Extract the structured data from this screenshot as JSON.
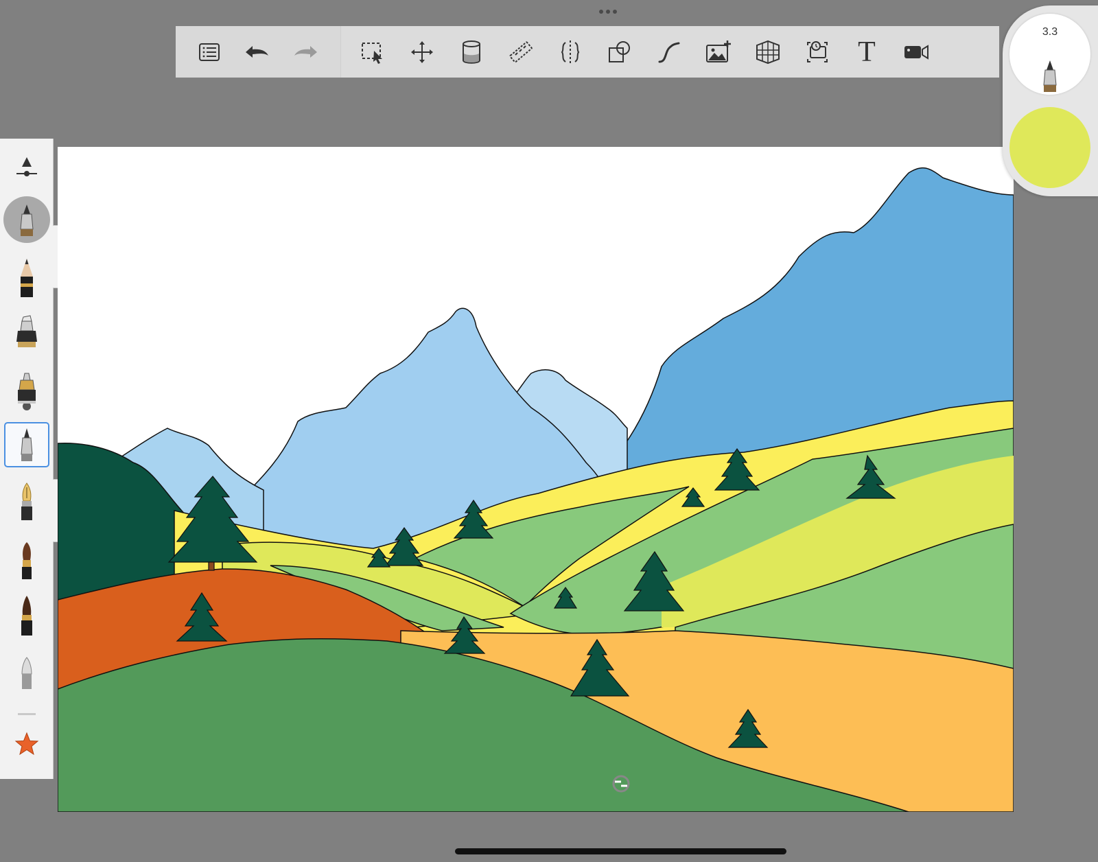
{
  "toolbar": {
    "items": [
      {
        "name": "layers-list-icon"
      },
      {
        "name": "undo-icon"
      },
      {
        "name": "redo-icon"
      },
      {
        "name": "selection-icon"
      },
      {
        "name": "transform-icon"
      },
      {
        "name": "fill-bucket-icon"
      },
      {
        "name": "ruler-icon"
      },
      {
        "name": "symmetry-icon"
      },
      {
        "name": "shapes-icon"
      },
      {
        "name": "curve-icon"
      },
      {
        "name": "import-image-icon"
      },
      {
        "name": "perspective-guide-icon"
      },
      {
        "name": "time-lapse-icon"
      },
      {
        "name": "text-icon"
      },
      {
        "name": "video-icon"
      }
    ],
    "text_glyph": "T"
  },
  "brush_puck": {
    "size_value": "3.3",
    "color": "#dfe85a"
  },
  "left_panel": {
    "tools": [
      {
        "name": "brush-size-opacity-icon"
      },
      {
        "name": "current-brush-icon"
      },
      {
        "name": "pencil-icon"
      },
      {
        "name": "marker-icon"
      },
      {
        "name": "airbrush-icon"
      },
      {
        "name": "ballpoint-pen-icon",
        "selected": true
      },
      {
        "name": "fountain-pen-icon"
      },
      {
        "name": "paint-brush-icon"
      },
      {
        "name": "ink-brush-icon"
      },
      {
        "name": "eraser-icon"
      },
      {
        "name": "favorites-star-icon"
      }
    ]
  },
  "colors": {
    "sky": "#ffffff",
    "mountain_far_light": "#a8d3f0",
    "mountain_mid": "#a0cef0",
    "mountain_right": "#64acdc",
    "forest_dark": "#0b5240",
    "hill_yellow": "#fbee5a",
    "hill_lime": "#dfe85a",
    "hill_light_green": "#88c97c",
    "hill_orange_red": "#d95f1d",
    "hill_orange": "#fdbe55",
    "hill_green": "#539a5a",
    "accent_blue": "#4a90e2"
  }
}
